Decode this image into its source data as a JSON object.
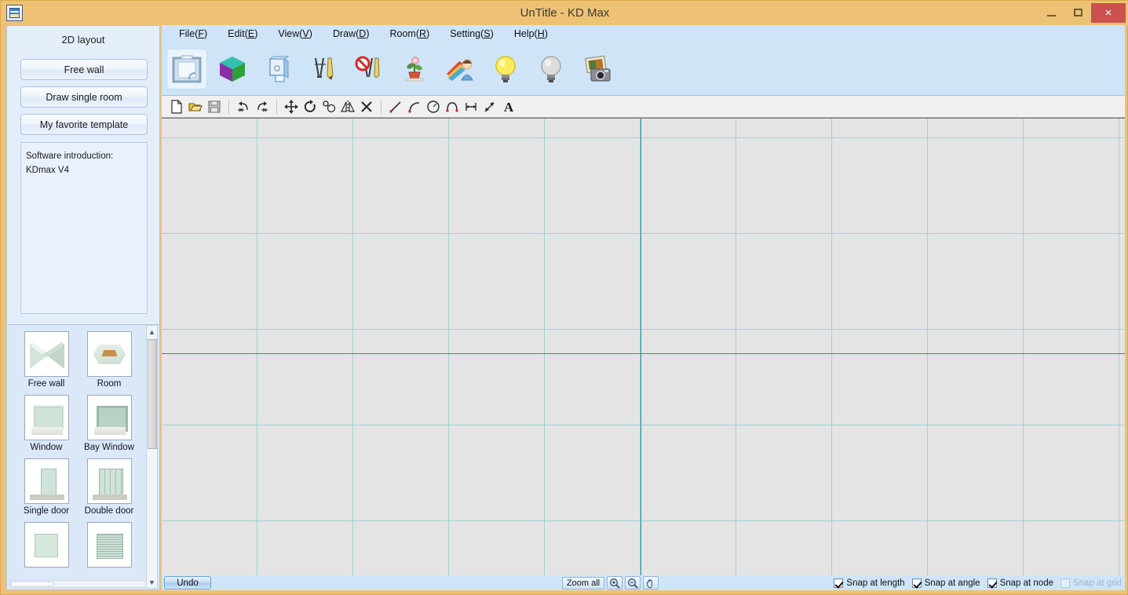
{
  "window": {
    "title": "UnTitle - KD Max",
    "app_icon": "kdmax-app-icon",
    "minimize": "",
    "maximize": "",
    "close": "×"
  },
  "sidebar": {
    "heading": "2D layout",
    "buttons": [
      {
        "label": "Free wall",
        "name": "free-wall"
      },
      {
        "label": "Draw single room",
        "name": "draw-single-room"
      },
      {
        "label": "My favorite template",
        "name": "my-favorite-template"
      }
    ],
    "intro": {
      "line1": "Software introduction:",
      "line2": "KDmax V4"
    },
    "palette_items": [
      {
        "label": "Free wall",
        "art": "art-freewall",
        "icon": "free-wall-thumb"
      },
      {
        "label": "Room",
        "art": "art-room",
        "icon": "room-thumb"
      },
      {
        "label": "Window",
        "art": "art-window",
        "icon": "window-thumb"
      },
      {
        "label": "Bay Window",
        "art": "art-baywindow",
        "icon": "bay-window-thumb"
      },
      {
        "label": "Single door",
        "art": "art-singledoor",
        "icon": "single-door-thumb"
      },
      {
        "label": "Double door",
        "art": "art-doubledoor",
        "icon": "double-door-thumb"
      },
      {
        "label": "",
        "art": "art-partial-a",
        "icon": "partial-item-a-thumb"
      },
      {
        "label": "",
        "art": "art-partial-b",
        "icon": "partial-item-b-thumb"
      }
    ]
  },
  "menubar": {
    "items": [
      {
        "label": "File",
        "accel": "F"
      },
      {
        "label": "Edit",
        "accel": "E"
      },
      {
        "label": "View",
        "accel": "V"
      },
      {
        "label": "Draw",
        "accel": "D"
      },
      {
        "label": "Room",
        "accel": "R"
      },
      {
        "label": "Setting",
        "accel": "S"
      },
      {
        "label": "Help",
        "accel": "H"
      }
    ]
  },
  "toolbar_main": {
    "buttons": [
      {
        "name": "2d-layout-icon",
        "selected": true
      },
      {
        "name": "3d-cube-icon",
        "selected": false
      },
      {
        "name": "cabinet-model-icon",
        "selected": false
      },
      {
        "name": "dimension-on-icon",
        "selected": false
      },
      {
        "name": "dimension-off-icon",
        "selected": false
      },
      {
        "name": "plant-decoration-icon",
        "selected": false
      },
      {
        "name": "material-palette-icon",
        "selected": false
      },
      {
        "name": "light-on-icon",
        "selected": false
      },
      {
        "name": "light-off-icon",
        "selected": false
      },
      {
        "name": "render-photo-icon",
        "selected": false
      }
    ]
  },
  "toolbar_draw": {
    "buttons": [
      {
        "name": "new-file-icon"
      },
      {
        "name": "open-file-icon"
      },
      {
        "name": "save-file-icon"
      },
      {
        "name": "sep"
      },
      {
        "name": "undo-icon"
      },
      {
        "name": "redo-icon"
      },
      {
        "name": "sep"
      },
      {
        "name": "move-icon"
      },
      {
        "name": "rotate-icon"
      },
      {
        "name": "copy-icon"
      },
      {
        "name": "mirror-icon"
      },
      {
        "name": "delete-icon"
      },
      {
        "name": "sep"
      },
      {
        "name": "line-icon"
      },
      {
        "name": "arc-icon"
      },
      {
        "name": "circle-icon"
      },
      {
        "name": "polyline-icon"
      },
      {
        "name": "dimension-linear-icon"
      },
      {
        "name": "dimension-leader-icon"
      },
      {
        "name": "text-icon"
      }
    ]
  },
  "statusbar": {
    "undo_label": "Undo",
    "zoom_all_label": "Zoom all",
    "zoom_in_icon": "zoom-in-icon",
    "zoom_out_icon": "zoom-out-icon",
    "pan_icon": "pan-hand-icon",
    "snaps": [
      {
        "label": "Snap at length",
        "checked": true,
        "disabled": false,
        "name": "snap-at-length"
      },
      {
        "label": "Snap at angle",
        "checked": true,
        "disabled": false,
        "name": "snap-at-angle"
      },
      {
        "label": "Snap at node",
        "checked": true,
        "disabled": false,
        "name": "snap-at-node"
      },
      {
        "label": "Snap at grid",
        "checked": false,
        "disabled": true,
        "name": "snap-at-grid"
      }
    ]
  },
  "canvas": {
    "grid_color": "#9fd2d2",
    "axis_color": "#2f8f96",
    "background": "#e4e4e4",
    "grid_spacing_px": 122
  }
}
